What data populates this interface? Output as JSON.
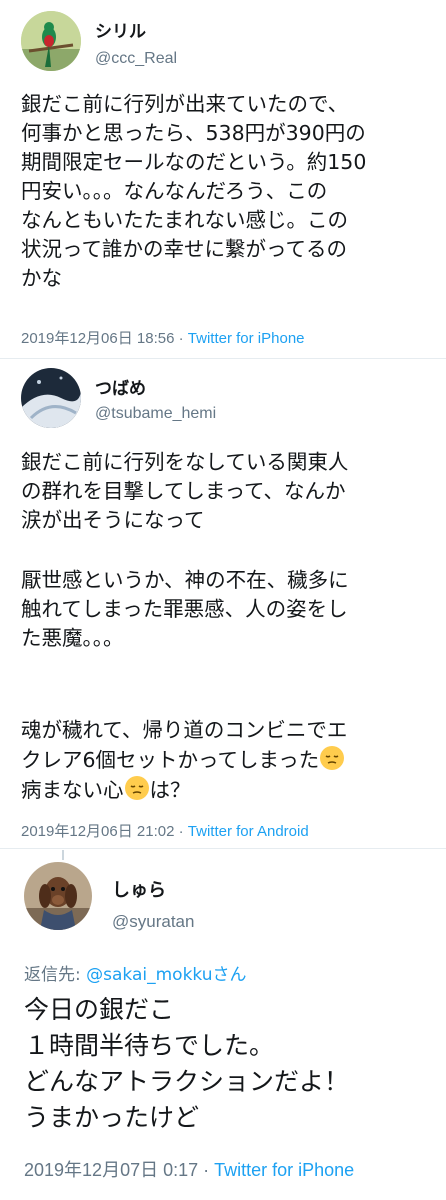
{
  "tweets": [
    {
      "display_name": "シリル",
      "handle": "@ccc_Real",
      "text": "銀だこ前に行列が出来ていたので、\n何事かと思ったら、538円が390円の\n期間限定セールなのだという。約150\n円安い。。。なんなんだろう、この\nなんともいたたまれない感じ。この\n状況って誰かの幸せに繋がってるの\nかな",
      "timestamp": "2019年12月06日 18:56",
      "separator": " · ",
      "source": "Twitter for iPhone"
    },
    {
      "display_name": "つばめ",
      "handle": "@tsubame_hemi",
      "paragraph1": "銀だこ前に行列をなしている関東人\nの群れを目撃してしまって、なんか\n涙が出そうになって",
      "paragraph2": "厭世感というか、神の不在、穢多に\n触れてしまった罪悪感、人の姿をし\nた悪魔。。。",
      "paragraph3_part1": "魂が穢れて、帰り道のコンビニでエ\nクレア6個セットかってしまった",
      "paragraph3_part2": "病まない心",
      "paragraph3_part3": "は？",
      "emoji_name": "pensive-face-emoji",
      "timestamp": "2019年12月06日 21:02",
      "separator": " · ",
      "source": "Twitter for Android"
    },
    {
      "display_name": "しゅら",
      "handle": "@syuratan",
      "reply_prefix": "返信先: ",
      "reply_mention": "@sakai_mokkuさん",
      "text": "今日の銀だこ\n１時間半待ちでした。\nどんなアトラクションだよ！\nうまかったけど",
      "timestamp": "2019年12月07日 0:17",
      "separator": " · ",
      "source": "Twitter for iPhone"
    }
  ],
  "colors": {
    "text": "#14171a",
    "secondary": "#657786",
    "link": "#1da1f2",
    "divider": "#e6ecf0"
  }
}
